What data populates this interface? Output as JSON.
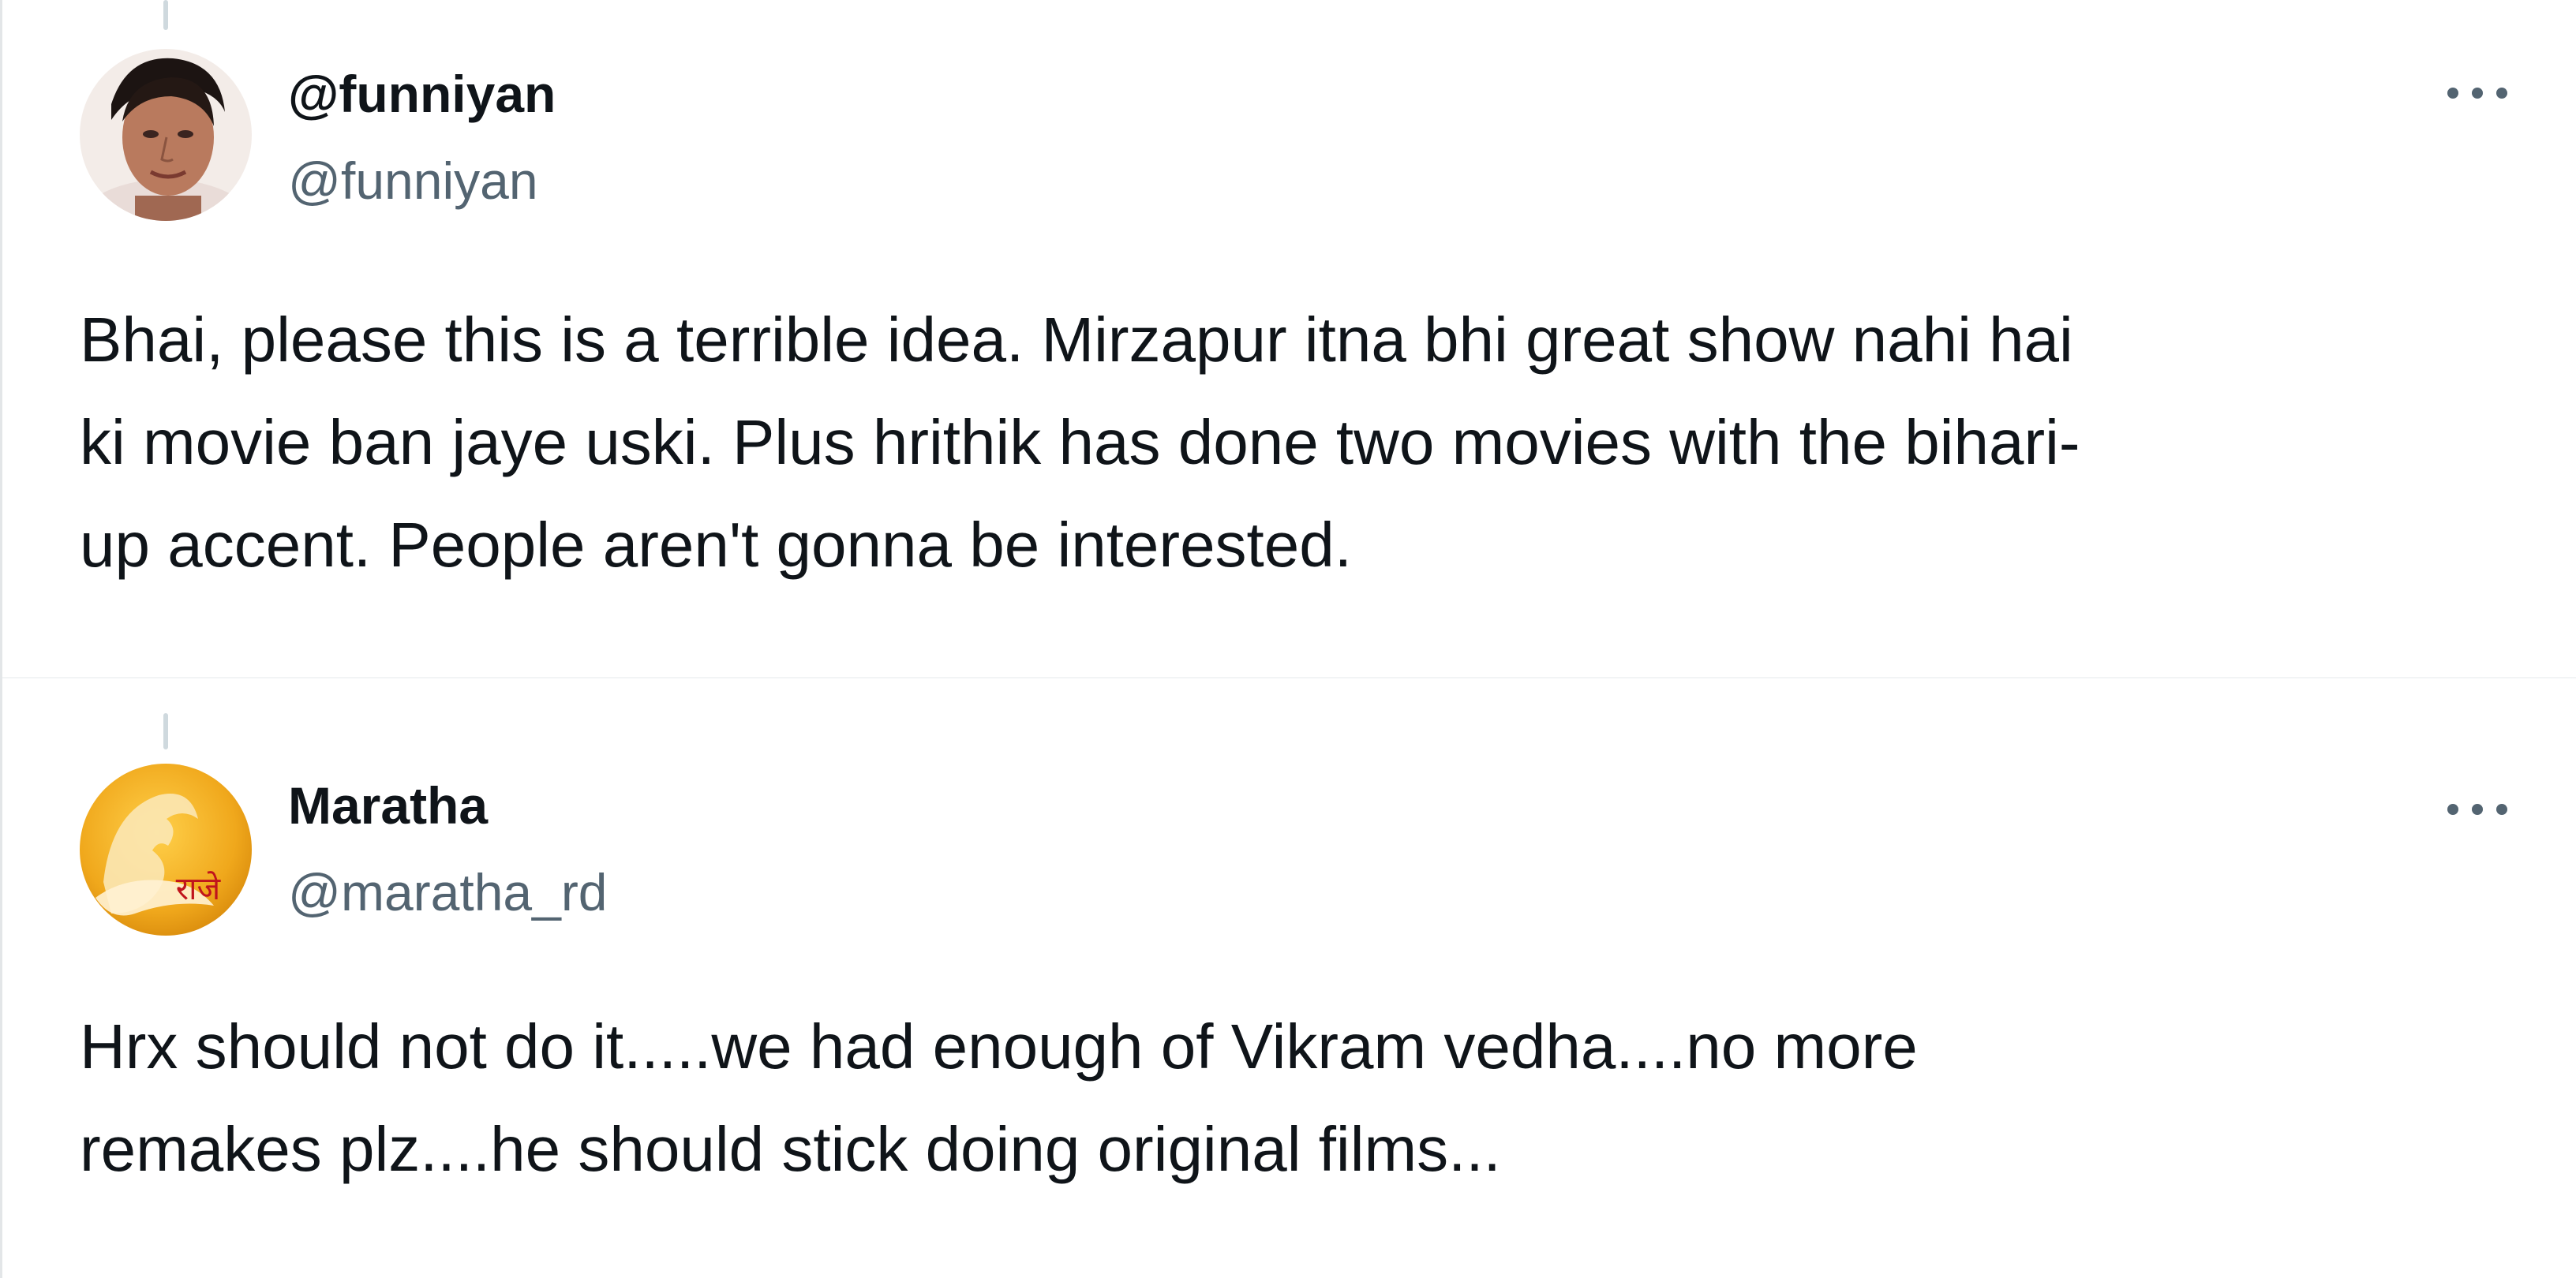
{
  "tweets": [
    {
      "display_name": "@funniyan",
      "handle": "@funniyan",
      "avatar_icon": "user-photo-avatar",
      "more_icon": "more-horizontal-icon",
      "text": "Bhai, please this is a terrible idea. Mirzapur itna bhi great show nahi hai\nki movie ban jaye uski. Plus hrithik has done two movies with the bihari-\nup accent. People aren't gonna be interested."
    },
    {
      "display_name": "Maratha",
      "handle": "@maratha_rd",
      "avatar_icon": "maratha-logo-avatar",
      "avatar_logo_text": "राजे",
      "more_icon": "more-horizontal-icon",
      "text": "Hrx should not do it.....we had enough of Vikram vedha....no more\nremakes plz....he should stick doing original films..."
    }
  ],
  "colors": {
    "primary_text": "#0f1419",
    "secondary_text": "#536471",
    "thread_line": "#cfd9de",
    "maratha_gold": "#f0a81c"
  }
}
